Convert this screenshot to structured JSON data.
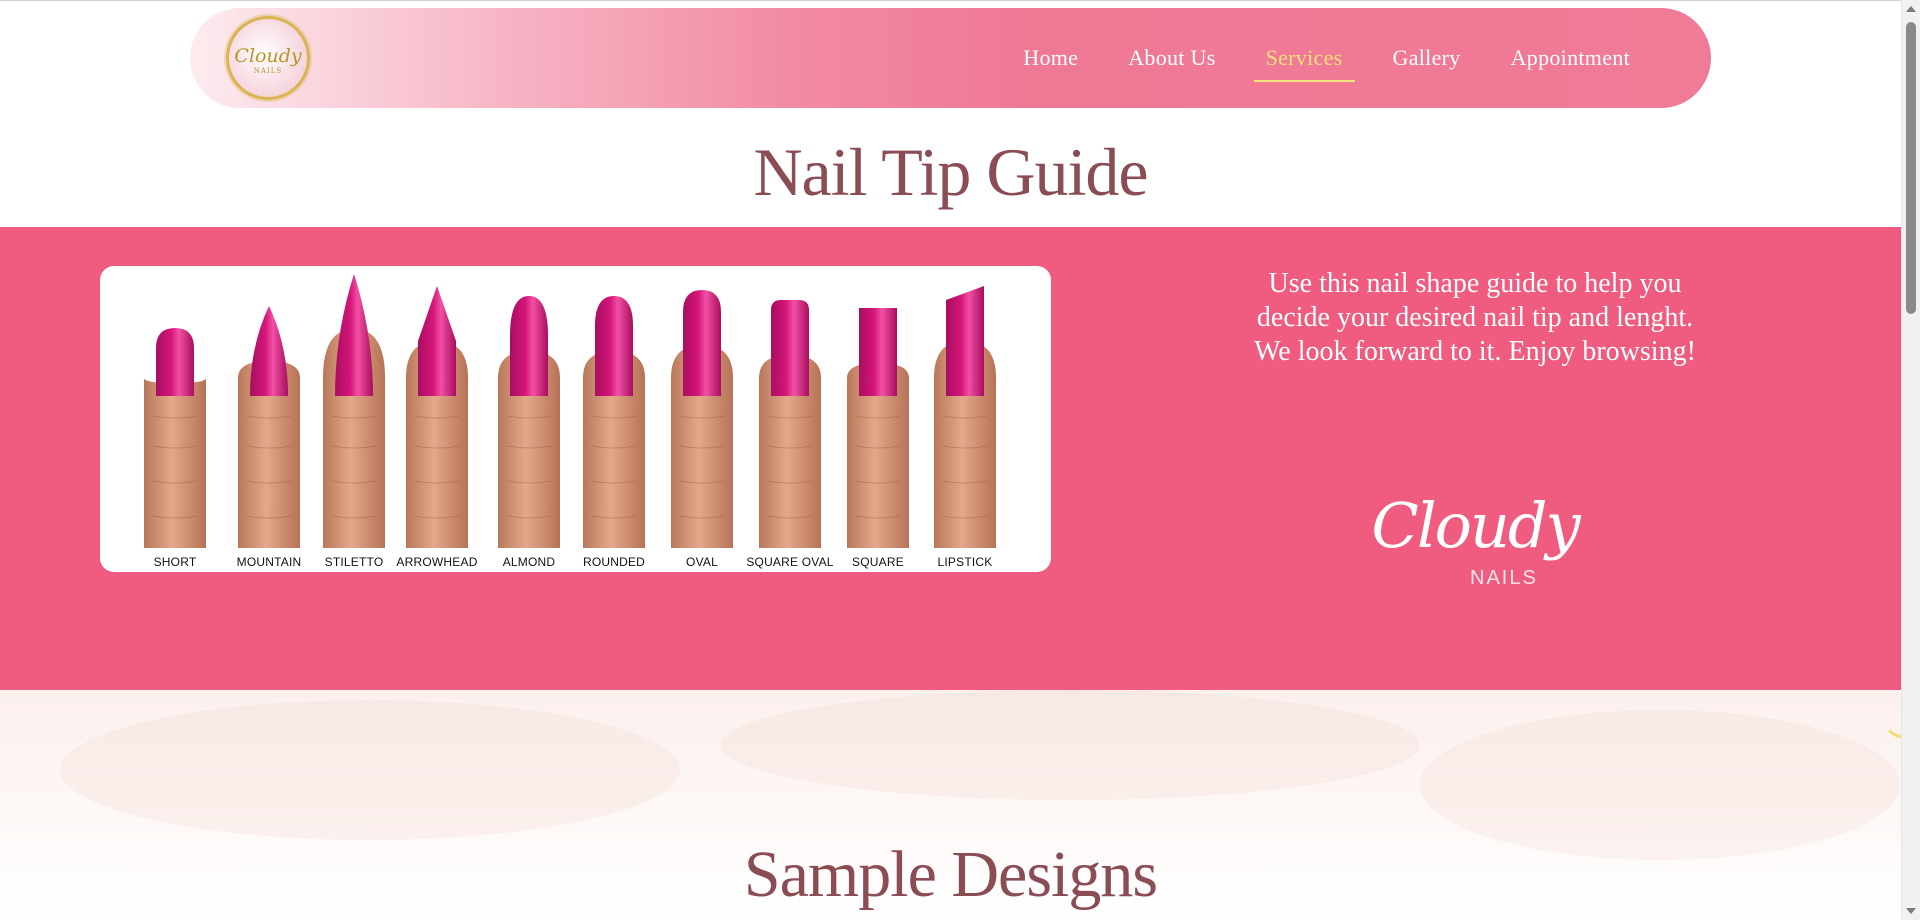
{
  "header": {
    "logo_text": "Cloudy",
    "logo_sub": "NAILS",
    "nav": [
      {
        "label": "Home"
      },
      {
        "label": "About Us"
      },
      {
        "label": "Services",
        "active": true
      },
      {
        "label": "Gallery"
      },
      {
        "label": "Appointment"
      }
    ]
  },
  "guide": {
    "title": "Nail Tip Guide",
    "shapes": [
      "SHORT",
      "MOUNTAIN",
      "STILETTO",
      "ARROWHEAD",
      "ALMOND",
      "ROUNDED",
      "OVAL",
      "SQUARE OVAL",
      "SQUARE",
      "LIPSTICK"
    ],
    "blurb": "Use this nail shape guide to help you decide your desired nail tip and lenght. We look forward to it. Enjoy browsing!",
    "brand_script": "Cloudy",
    "brand_nails": "NAILS"
  },
  "sample": {
    "title": "Sample Designs"
  },
  "colors": {
    "band": "#ef5c7f",
    "heading": "#8b4d54",
    "nav_active": "#f6e27a",
    "nail": "#d4167a"
  }
}
